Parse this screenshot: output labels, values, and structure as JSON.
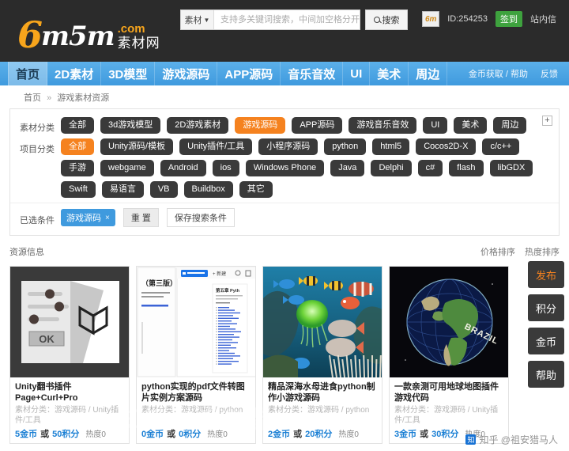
{
  "site": {
    "logo_num": "6",
    "logo_mid": "m5m",
    "logo_com": ".com",
    "logo_cn": "素材网"
  },
  "search": {
    "category": "素材",
    "caret": "▼",
    "placeholder": "支持多关键词搜索，中间加空格分开",
    "value": "",
    "button": "搜索"
  },
  "user": {
    "avatar_glyph": "6m",
    "id": "ID:254253",
    "signin": "签到",
    "message": "站内信"
  },
  "nav": {
    "items": [
      {
        "label": "首页",
        "active": true
      },
      {
        "label": "2D素材",
        "active": false
      },
      {
        "label": "3D模型",
        "active": false
      },
      {
        "label": "游戏源码",
        "active": false
      },
      {
        "label": "APP源码",
        "active": false
      },
      {
        "label": "音乐音效",
        "active": false
      },
      {
        "label": "UI",
        "active": false
      },
      {
        "label": "美术",
        "active": false
      },
      {
        "label": "周边",
        "active": false
      }
    ],
    "help": "金币获取 / 帮助",
    "feedback": "反馈"
  },
  "breadcrumb": {
    "home": "首页",
    "sep": "»",
    "current": "游戏素材资源"
  },
  "filters": {
    "collapse_icon": "+",
    "groups": [
      {
        "label": "素材分类",
        "chips": [
          {
            "label": "全部",
            "active": false
          },
          {
            "label": "3d游戏模型",
            "active": false
          },
          {
            "label": "2D游戏素材",
            "active": false
          },
          {
            "label": "游戏源码",
            "active": true
          },
          {
            "label": "APP源码",
            "active": false
          },
          {
            "label": "游戏音乐音效",
            "active": false
          },
          {
            "label": "UI",
            "active": false
          },
          {
            "label": "美术",
            "active": false
          },
          {
            "label": "周边",
            "active": false
          }
        ]
      },
      {
        "label": "项目分类",
        "chips": [
          {
            "label": "全部",
            "active": true
          },
          {
            "label": "Unity源码/模板",
            "active": false
          },
          {
            "label": "Unity插件/工具",
            "active": false
          },
          {
            "label": "小程序源码",
            "active": false
          },
          {
            "label": "python",
            "active": false
          },
          {
            "label": "html5",
            "active": false
          },
          {
            "label": "Cocos2D-X",
            "active": false
          },
          {
            "label": "c/c++",
            "active": false
          },
          {
            "label": "手游",
            "active": false
          },
          {
            "label": "webgame",
            "active": false
          },
          {
            "label": "Android",
            "active": false
          },
          {
            "label": "ios",
            "active": false
          },
          {
            "label": "Windows Phone",
            "active": false
          },
          {
            "label": "Java",
            "active": false
          },
          {
            "label": "Delphi",
            "active": false
          },
          {
            "label": "c#",
            "active": false
          },
          {
            "label": "flash",
            "active": false
          },
          {
            "label": "libGDX",
            "active": false
          },
          {
            "label": "Swift",
            "active": false
          },
          {
            "label": "易语言",
            "active": false
          },
          {
            "label": "VB",
            "active": false
          },
          {
            "label": "Buildbox",
            "active": false
          },
          {
            "label": "其它",
            "active": false
          }
        ]
      }
    ],
    "selected_label": "已选条件",
    "selected_tags": [
      {
        "label": "游戏源码",
        "close": "×"
      }
    ],
    "reset_button": "重 置",
    "save_button": "保存搜索条件"
  },
  "results": {
    "title": "资源信息",
    "sort_price": "价格排序",
    "sort_hot": "热度排序",
    "cards": [
      {
        "title": "Unity翻书插件 Page+Curl+Pro",
        "category": "素材分类：游戏源码 / Unity插件/工具",
        "price_coin": "5金币",
        "price_or": "或",
        "price_point": "50积分",
        "hot": "热度0",
        "image": "unity-book-plugin"
      },
      {
        "title": "python实现的pdf文件转图片实例方案源码",
        "category": "素材分类：游戏源码 / python",
        "price_coin": "0金币",
        "price_or": "或",
        "price_point": "0积分",
        "hot": "热度0",
        "image": "pdf-to-image-doc"
      },
      {
        "title": "精品深海水母进食python制作小游戏源码",
        "category": "素材分类：游戏源码 / python",
        "price_coin": "2金币",
        "price_or": "或",
        "price_point": "20积分",
        "hot": "热度0",
        "image": "deep-sea-jellyfish"
      },
      {
        "title": "一款亲测可用地球地图插件游戏代码",
        "category": "素材分类：游戏源码 / Unity插件/工具",
        "price_coin": "3金币",
        "price_or": "或",
        "price_point": "30积分",
        "hot": "热度0",
        "image": "earth-globe-brazil"
      }
    ]
  },
  "side_buttons": [
    {
      "label": "发布",
      "accent": true
    },
    {
      "label": "积分",
      "accent": false
    },
    {
      "label": "金币",
      "accent": false
    },
    {
      "label": "帮助",
      "accent": false
    }
  ],
  "watermark": {
    "small": "知乎 @祖安猎马人",
    "big": "知乎 @祖安猎",
    "logo": "知"
  },
  "colors": {
    "header_bg": "#2b2b2b",
    "nav_bg": "#4fa8e8",
    "accent_orange": "#f5821f",
    "accent_blue": "#3f9ade",
    "chip_dark": "#3a3a3a",
    "signin_green": "#3ea23e",
    "price_blue": "#1a7fd4"
  }
}
